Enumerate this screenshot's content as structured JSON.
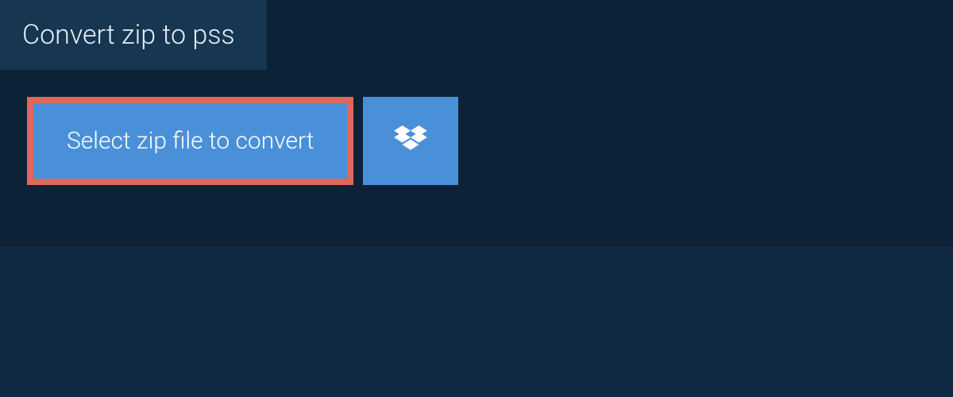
{
  "tab": {
    "title": "Convert zip to pss"
  },
  "actions": {
    "select_file_label": "Select zip file to convert"
  },
  "colors": {
    "accent": "#4a90d9",
    "highlight_border": "#e06759",
    "background_dark": "#0d2236",
    "background_panel": "#163651",
    "page": "#102a43"
  }
}
